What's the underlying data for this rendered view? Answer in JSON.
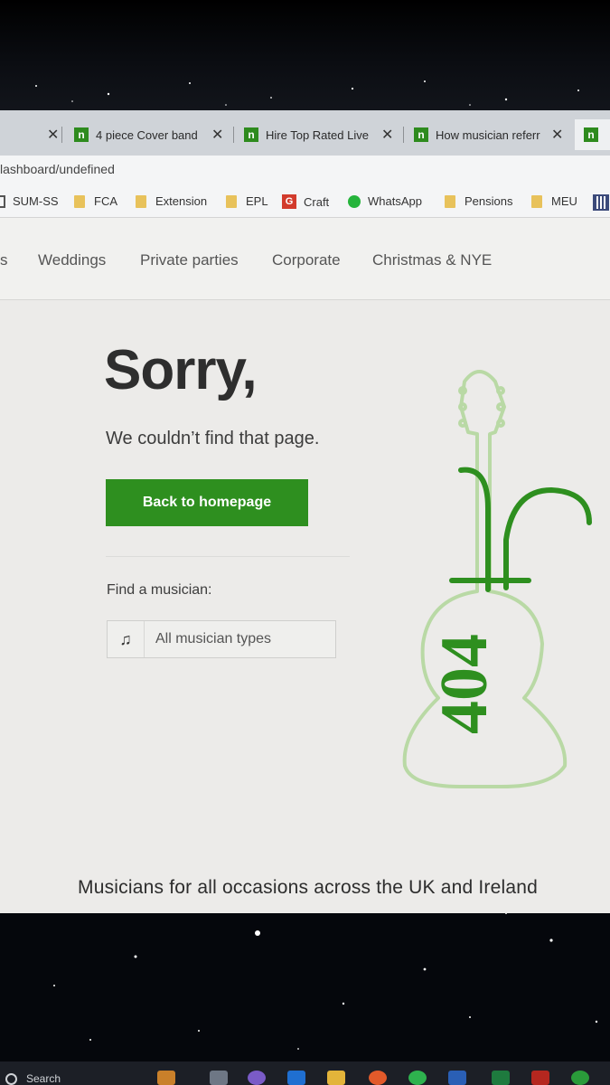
{
  "browser": {
    "tabs": [
      {
        "title": "4 piece Cover band",
        "close": "✕"
      },
      {
        "title": "Hire Top Rated Live",
        "close": "✕"
      },
      {
        "title": "How musician referr",
        "close": "✕"
      }
    ],
    "tab_favicon": "n",
    "first_tab_close": "✕",
    "address": "lashboard/undefined",
    "bookmarks": [
      "SUM-SS",
      "FCA",
      "Extension",
      "EPL",
      "Craft",
      "WhatsApp",
      "Pensions",
      "MEU"
    ],
    "google_letter": "G"
  },
  "site_nav": {
    "partial": "s",
    "links": [
      "Weddings",
      "Private parties",
      "Corporate",
      "Christmas & NYE"
    ]
  },
  "error": {
    "title": "Sorry,",
    "message": "We couldn’t find that page.",
    "button": "Back to homepage",
    "code": "404"
  },
  "finder": {
    "label": "Find a musician:",
    "select_value": "All musician types",
    "icon": "music-note-icon"
  },
  "footer": {
    "tagline": "Musicians for all occasions across the UK and Ireland"
  },
  "taskbar": {
    "search": "Search"
  },
  "colors": {
    "brand_green": "#2e8f1f",
    "guitar_light": "#b7d9a2"
  }
}
